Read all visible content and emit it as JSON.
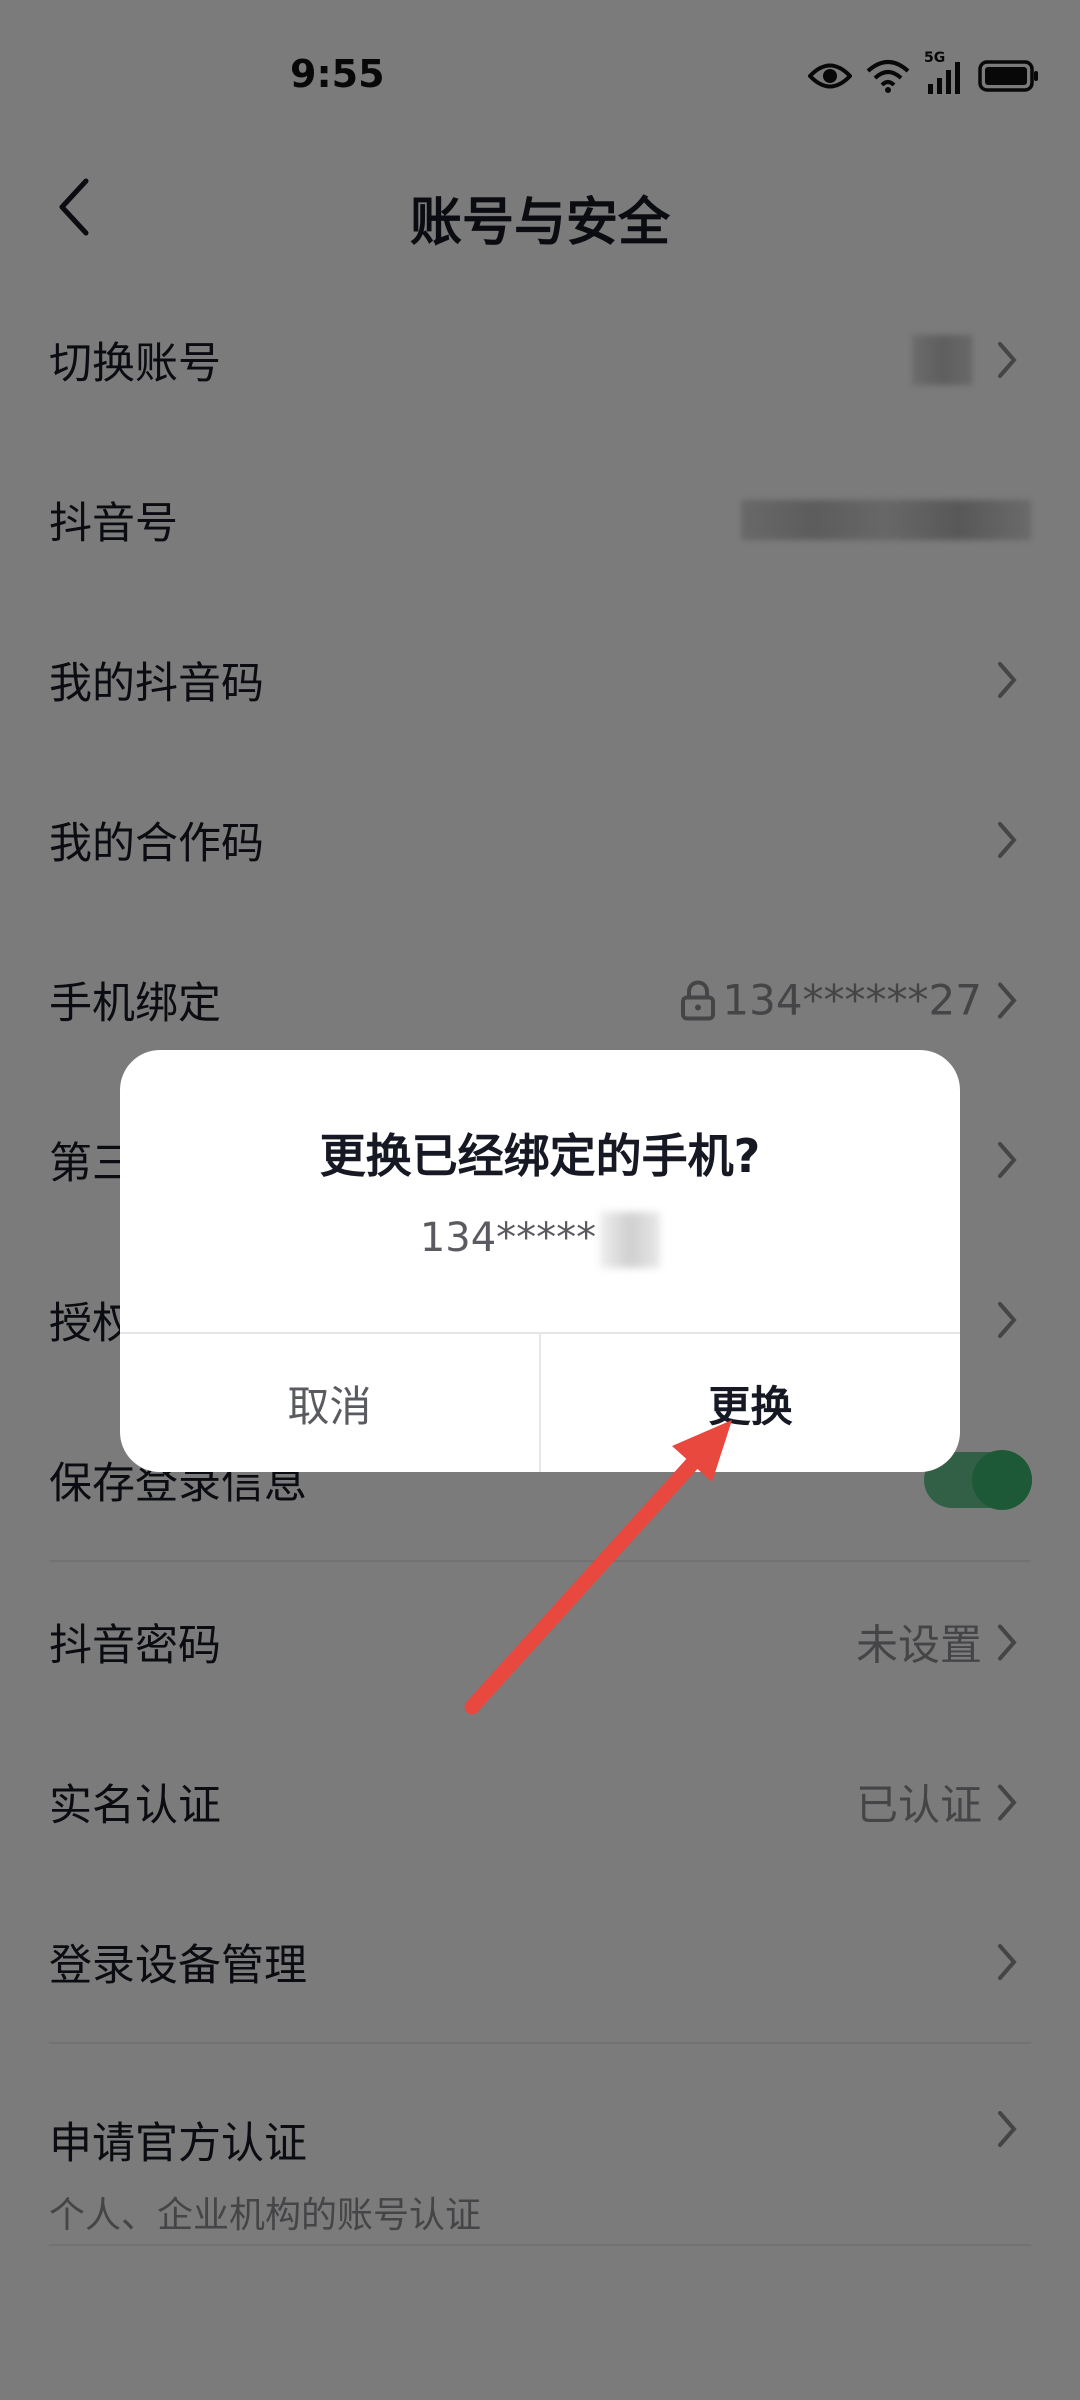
{
  "status": {
    "time": "9:55",
    "network": "5G"
  },
  "nav": {
    "title": "账号与安全"
  },
  "rows": [
    {
      "label": "切换账号"
    },
    {
      "label": "抖音号"
    },
    {
      "label": "我的抖音码"
    },
    {
      "label": "我的合作码"
    },
    {
      "label": "手机绑定",
      "value": "134******27"
    },
    {
      "label": "第三方账号绑定"
    },
    {
      "label": "授权管理"
    },
    {
      "label": "保存登录信息",
      "toggle_on": true
    },
    {
      "label": "抖音密码",
      "value": "未设置"
    },
    {
      "label": "实名认证",
      "value": "已认证"
    },
    {
      "label": "登录设备管理"
    },
    {
      "label": "申请官方认证",
      "sublabel": "个人、企业机构的账号认证"
    }
  ],
  "dialog": {
    "title": "更换已经绑定的手机?",
    "subtitle": "134*****",
    "cancel_label": "取消",
    "confirm_label": "更换"
  },
  "colors": {
    "annotation_arrow": "#e8483d",
    "toggle": "#3bb26f"
  }
}
